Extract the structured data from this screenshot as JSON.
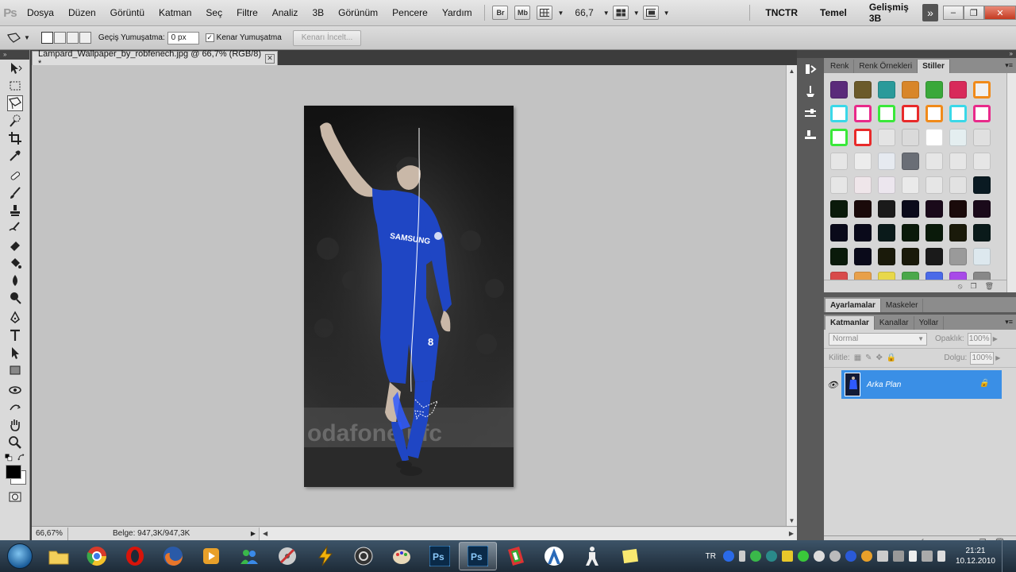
{
  "app": {
    "logo": "Ps"
  },
  "menu": [
    "Dosya",
    "Düzen",
    "Görüntü",
    "Katman",
    "Seç",
    "Filtre",
    "Analiz",
    "3B",
    "Görünüm",
    "Pencere",
    "Yardım"
  ],
  "appbar": {
    "bridge": "Br",
    "minibridge": "Mb",
    "zoom": "66,7"
  },
  "workspaces": [
    "TNCTR",
    "Temel",
    "Gelişmiş 3B"
  ],
  "workspace_more": "»",
  "window_controls": {
    "min": "–",
    "restore": "❐",
    "close": "✕"
  },
  "options": {
    "feather_label": "Geçiş Yumuşatma:",
    "feather_value": "0 px",
    "antialias_label": "Kenar Yumuşatma",
    "antialias_checked": "✓",
    "refine_edge": "Kenarı İncelt..."
  },
  "document": {
    "tab_title": "Lampard_Wallpaper_by_robfenech.jpg @ 66,7% (RGB/8) *",
    "close": "✕"
  },
  "image_text": {
    "sponsor": "SAMSUNG",
    "number": "8",
    "board": "odafone   ufc"
  },
  "status": {
    "zoom": "66,67%",
    "doc_size": "Belge: 947,3K/947,3K",
    "arrow": "▶"
  },
  "panels": {
    "top_tabs": [
      "Renk",
      "Renk Örnekleri",
      "Stiller"
    ],
    "mid_tabs": [
      "Ayarlamalar",
      "Maskeler"
    ],
    "layer_tabs": [
      "Katmanlar",
      "Kanallar",
      "Yollar"
    ],
    "blend_mode": "Normal",
    "opacity_label": "Opaklık:",
    "opacity_value": "100%",
    "lock_label": "Kilitle:",
    "fill_label": "Dolgu:",
    "fill_value": "100%",
    "layer_name": "Arka Plan"
  },
  "style_swatches": [
    "#5a2a7a",
    "#6b5a2a",
    "#2a9a9a",
    "#d8862a",
    "#3aa83a",
    "#d82a5a",
    "#f0f0f0",
    "#ffffff",
    "#ffffff",
    "#ffffff",
    "#ffffff",
    "#ffffff",
    "#ffffff",
    "#ffffff",
    "#ffffff",
    "#ffffff",
    "#e4e4e4",
    "#dadada",
    "#ffffff",
    "#e4eef0",
    "#e0e0e0",
    "#e6e6e6",
    "#ececec",
    "#e6eaf0",
    "#6a6e76",
    "#e6e6e6",
    "#e6e6e6",
    "#e6e6e6",
    "#e6e6e6",
    "#efe6ea",
    "#ece6ee",
    "#eaeaea",
    "#e6e6e6",
    "#e2e2e2",
    "#0a1a22",
    "#0a1a0a",
    "#1a0a0a",
    "#1a1a1a",
    "#0a0a1a",
    "#1a0a1a",
    "#1a0a0a",
    "#1a0a1a",
    "#0a0a1a",
    "#0a0a1a",
    "#0a1a1a",
    "#0a1a0a",
    "#0a1a0a",
    "#1a1a0a",
    "#0a1a1a",
    "#0a1a0a",
    "#0a0a1a",
    "#1a1a0a",
    "#1a1a0a",
    "#1a1a1a",
    "#9a9a9a",
    "#dde8ee",
    "#d84a4a",
    "#e8a04a",
    "#e8d84a",
    "#4aa84a",
    "#4a6ae8",
    "#a84ae8",
    "#888888"
  ],
  "style_ring_colors": [
    "#3ad8e8",
    "#e82a8a",
    "#3ae83a",
    "#e82a2a",
    "#f08a1a",
    "#3ad8e8",
    "#e82a8a",
    "#3ae83a",
    "#e82a2a"
  ],
  "taskbar": {
    "lang": "TR",
    "time": "21:21",
    "date": "10.12.2010"
  }
}
